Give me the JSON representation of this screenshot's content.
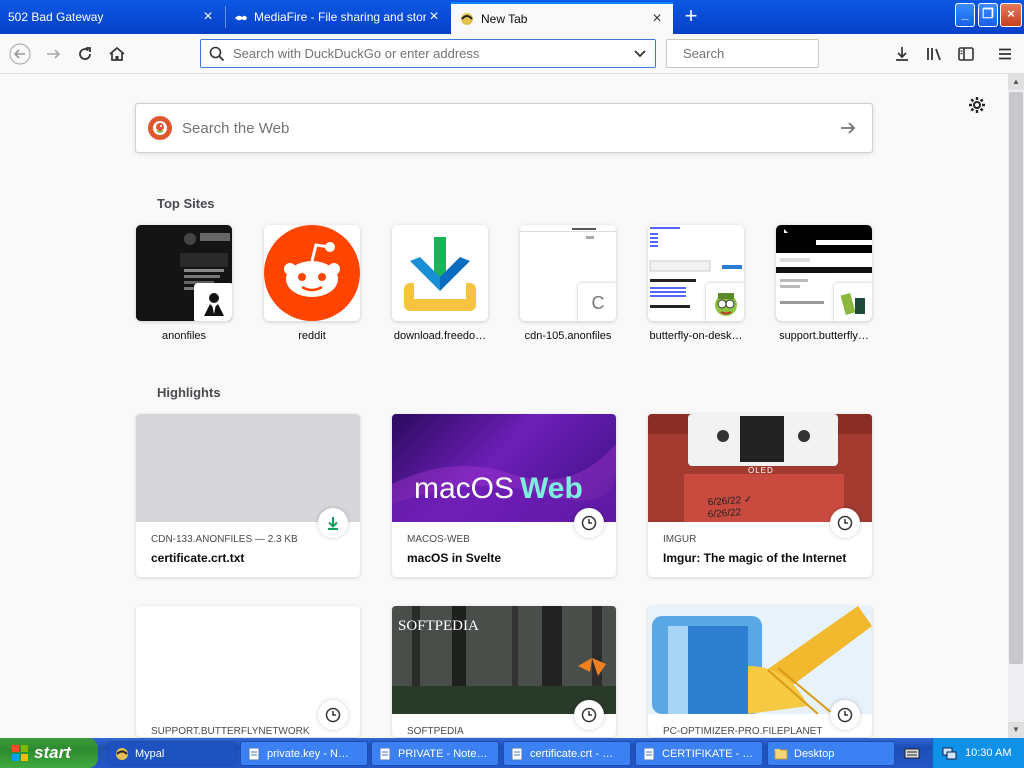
{
  "tabs": [
    {
      "title": "502 Bad Gateway",
      "active": false
    },
    {
      "title": "MediaFire - File sharing and storage",
      "active": false
    },
    {
      "title": "New Tab",
      "active": true
    }
  ],
  "navbar": {
    "url_placeholder": "Search with DuckDuckGo or enter address",
    "search_placeholder": "Search"
  },
  "newtab": {
    "web_search_placeholder": "Search the Web",
    "top_sites_title": "Top Sites",
    "highlights_title": "Highlights",
    "top_sites": [
      {
        "label": "anonfiles"
      },
      {
        "label": "reddit"
      },
      {
        "label": "download.freedo…"
      },
      {
        "label": "cdn-105.anonfiles"
      },
      {
        "label": "butterfly-on-desk…"
      },
      {
        "label": "support.butterfly…"
      }
    ],
    "highlights": [
      {
        "meta": "CDN-133.ANONFILES — 2.3 KB",
        "title": "certificate.crt.txt",
        "icon": "download-icon"
      },
      {
        "meta": "MACOS-WEB",
        "title": "macOS in Svelte",
        "icon": "history-icon",
        "thumb_text_a": "macOS",
        "thumb_text_b": "Web"
      },
      {
        "meta": "IMGUR",
        "title": "Imgur: The magic of the Internet",
        "icon": "history-icon"
      },
      {
        "meta": "SUPPORT.BUTTERFLYNETWORK",
        "title": "",
        "icon": "history-icon"
      },
      {
        "meta": "SOFTPEDIA",
        "title": "",
        "icon": "history-icon",
        "thumb_text": "SOFTPEDIA"
      },
      {
        "meta": "PC-OPTIMIZER-PRO.FILEPLANET",
        "title": "",
        "icon": "history-icon"
      }
    ],
    "cdn_tile_letter": "C",
    "oled_text": "OLED"
  },
  "taskbar": {
    "start_label": "start",
    "buttons": [
      {
        "label": "Mypal"
      },
      {
        "label": "private.key - N…"
      },
      {
        "label": "PRIVATE - Note…"
      },
      {
        "label": "certificate.crt - …"
      },
      {
        "label": "CERTIFIKATE - …"
      },
      {
        "label": "Desktop"
      }
    ],
    "clock": "10:30 AM"
  },
  "colors": {
    "accent": "#0a84ff",
    "reddit": "#ff4500",
    "ddg": "#de5833",
    "taskbar": "#245edb",
    "start": "#3c9a3c"
  }
}
